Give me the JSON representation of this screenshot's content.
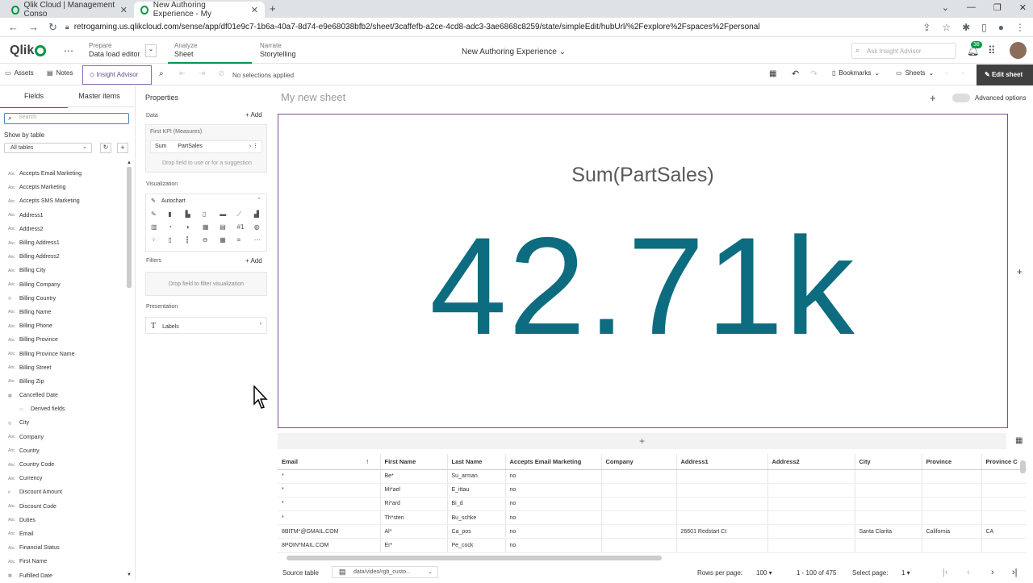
{
  "browser": {
    "tabs": [
      {
        "title": "Qlik Cloud | Management Conso"
      },
      {
        "title": "New Authoring Experience - My"
      }
    ],
    "url": "retrogaming.us.qlikcloud.com/sense/app/df01e9c7-1b6a-40a7-8d74-e9e68038bfb2/sheet/3caffefb-a2ce-4cd8-adc3-3ae6868c8259/state/simpleEdit/hubUrl/%2Fexplore%2Fspaces%2Fpersonal"
  },
  "header": {
    "logo": "Qlik",
    "nav": [
      {
        "section": "Prepare",
        "label": "Data load editor"
      },
      {
        "section": "Analyze",
        "label": "Sheet"
      },
      {
        "section": "Narrate",
        "label": "Storytelling"
      }
    ],
    "app_title": "New Authoring Experience",
    "ask_placeholder": "Ask Insight Advisor",
    "notif_count": "38"
  },
  "toolbar": {
    "assets": "Assets",
    "notes": "Notes",
    "insight_advisor": "Insight Advisor",
    "selections": "No selections applied",
    "bookmarks": "Bookmarks",
    "sheets": "Sheets",
    "edit_sheet": "Edit sheet"
  },
  "left_panel": {
    "tab_fields": "Fields",
    "tab_master": "Master items",
    "search_placeholder": "Search",
    "show_by": "Show by table",
    "table_select": "All tables",
    "fields": [
      {
        "type": "Abc",
        "name": "Accepts Email Marketing"
      },
      {
        "type": "Abc",
        "name": "Accepts Marketing"
      },
      {
        "type": "Abc",
        "name": "Accepts SMS Marketing"
      },
      {
        "type": "Abc",
        "name": "Address1"
      },
      {
        "type": "Abc",
        "name": "Address2"
      },
      {
        "type": "Abc",
        "name": "Billing Address1"
      },
      {
        "type": "Abc",
        "name": "Billing Address2"
      },
      {
        "type": "Abc",
        "name": "Billing City"
      },
      {
        "type": "Abc",
        "name": "Billing Company"
      },
      {
        "type": "geo",
        "name": "Billing Country"
      },
      {
        "type": "Abc",
        "name": "Billing Name"
      },
      {
        "type": "Abc",
        "name": "Billing Phone"
      },
      {
        "type": "Abc",
        "name": "Billing Province"
      },
      {
        "type": "Abc",
        "name": "Billing Province Name"
      },
      {
        "type": "Abc",
        "name": "Billing Street"
      },
      {
        "type": "Abc",
        "name": "Billing Zip"
      },
      {
        "type": "cal",
        "name": "Cancelled Date"
      },
      {
        "type": "sub",
        "name": "Derived fields"
      },
      {
        "type": "geo",
        "name": "City"
      },
      {
        "type": "Abc",
        "name": "Company"
      },
      {
        "type": "Abc",
        "name": "Country"
      },
      {
        "type": "Abc",
        "name": "Country Code"
      },
      {
        "type": "Abc",
        "name": "Currency"
      },
      {
        "type": "#",
        "name": "Discount Amount"
      },
      {
        "type": "Abc",
        "name": "Discount Code"
      },
      {
        "type": "Abc",
        "name": "Duties"
      },
      {
        "type": "Abc",
        "name": "Email"
      },
      {
        "type": "Abc",
        "name": "Financial Status"
      },
      {
        "type": "Abc",
        "name": "First Name"
      },
      {
        "type": "cal",
        "name": "Fulfilled Date"
      }
    ]
  },
  "properties": {
    "title": "Properties",
    "data": "Data",
    "add": "Add",
    "first_kpi": "First KPI (Measures)",
    "agg": "Sum",
    "measure": "PartSales",
    "drop_hint": "Drop field to use or for a suggestion",
    "visualization": "Visualization",
    "autochart": "Autochart",
    "filters": "Filters",
    "filters_add": "Add",
    "filter_hint": "Drop field to filter visualization",
    "presentation": "Presentation",
    "labels": "Labels"
  },
  "sheet": {
    "title": "My new sheet",
    "advanced": "Advanced options",
    "kpi_title": "Sum(PartSales)",
    "kpi_value": "42.71k",
    "add_row": "+"
  },
  "table": {
    "columns": [
      "Email",
      "First Name",
      "Last Name",
      "Accepts Email Marketing",
      "Company",
      "Address1",
      "Address2",
      "City",
      "Province",
      "Province C"
    ],
    "rows": [
      [
        "*",
        "Be*",
        "Su_arman",
        "no",
        "",
        "",
        "",
        "",
        "",
        ""
      ],
      [
        "*",
        "Mi*ael",
        "E_ittau",
        "no",
        "",
        "",
        "",
        "",
        "",
        ""
      ],
      [
        "*",
        "Ri*ard",
        "Bi_d",
        "no",
        "",
        "",
        "",
        "",
        "",
        ""
      ],
      [
        "*",
        "Th*sten",
        "Bu_schke",
        "no",
        "",
        "",
        "",
        "",
        "",
        ""
      ],
      [
        "8BITM*@GMAIL.COM",
        "Al*",
        "Ca_pos",
        "no",
        "",
        "26601 Redstart Ct",
        "",
        "Santa Clarita",
        "California",
        "CA"
      ],
      [
        "8POIN*MAIL.COM",
        "Er*",
        "Pe_cock",
        "no",
        "",
        "",
        "",
        "",
        "",
        ""
      ]
    ]
  },
  "footer": {
    "source_label": "Source table",
    "source_value": "data/video/rgb_custo...",
    "rows_per_page_label": "Rows per page:",
    "rows_per_page": "100",
    "range": "1 - 100 of 475",
    "select_page_label": "Select page:",
    "page": "1"
  }
}
